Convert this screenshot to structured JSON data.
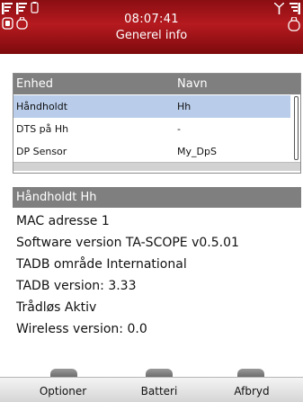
{
  "header": {
    "time": "08:07:41",
    "title": "Generel info",
    "icons": {
      "top_left_1": "signal-bars-icon",
      "top_left_2": "signal-bars-icon",
      "top_left_3": "handheld-device-icon",
      "bottom_left_1": "sensor-icon",
      "bottom_left_2": "sensor-outline-icon",
      "top_right_1": "antenna-icon",
      "top_right_2": "signal-bars-icon",
      "bottom_right": "sensor-outline-icon"
    }
  },
  "table": {
    "headers": [
      "Enhed",
      "Navn"
    ],
    "rows": [
      {
        "enhed": "Håndholdt",
        "navn": "Hh",
        "selected": true
      },
      {
        "enhed": "DTS på Hh",
        "navn": "-",
        "selected": false
      },
      {
        "enhed": "DP Sensor",
        "navn": "My_DpS",
        "selected": false
      }
    ]
  },
  "detail": {
    "title": "Håndholdt Hh",
    "lines": [
      "MAC adresse 1",
      "Software version TA-SCOPE v0.5.01",
      "TADB område International",
      "TADB version: 3.33",
      "Trådløs Aktiv",
      "Wireless version: 0.0"
    ]
  },
  "softkeys": {
    "left": "Optioner",
    "middle": "Batteri",
    "right": "Afbryd"
  },
  "colors": {
    "header_bg": "#a31318",
    "section_bar": "#7f7f7f",
    "selected_row": "#b9cdea"
  }
}
